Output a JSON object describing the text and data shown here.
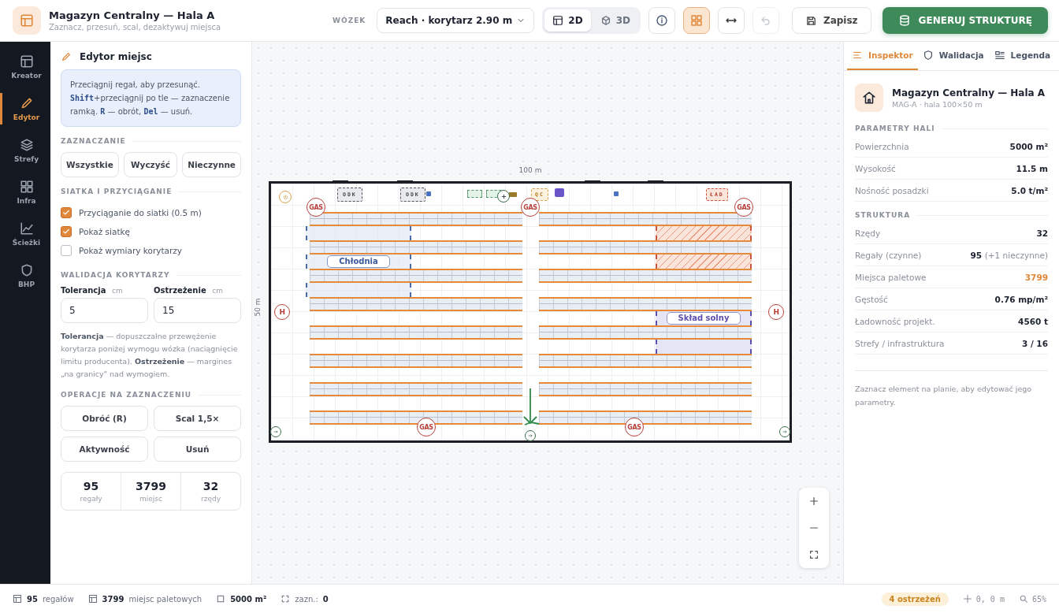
{
  "header": {
    "title": "Magazyn Centralny — Hala A",
    "subtitle": "Zaznacz, przesuń, scal, dezaktywuj miejsca",
    "truck_label": "WÓZEK",
    "truck_value": "Reach · korytarz 2.90 m",
    "views": [
      {
        "label": "2D",
        "kind": "plan",
        "selected": true
      },
      {
        "label": "3D",
        "kind": "cube",
        "selected": false
      }
    ],
    "tools": [
      {
        "kind": "info",
        "selected": false,
        "disabled": false
      },
      {
        "kind": "grid",
        "selected": true,
        "disabled": false
      },
      {
        "kind": "measure",
        "selected": false,
        "disabled": false
      },
      {
        "kind": "undo",
        "selected": false,
        "disabled": true
      }
    ],
    "save": "Zapisz",
    "generate": "GENERUJ STRUKTURĘ"
  },
  "nav": [
    {
      "label": "Kreator",
      "kind": "layout",
      "selected": false
    },
    {
      "label": "Edytor",
      "kind": "pencil",
      "selected": true
    },
    {
      "label": "Strefy",
      "kind": "layers",
      "selected": false
    },
    {
      "label": "Infra",
      "kind": "grid",
      "selected": false
    },
    {
      "label": "Ścieżki",
      "kind": "chart",
      "selected": false
    },
    {
      "label": "BHP",
      "kind": "shield",
      "selected": false
    }
  ],
  "editor": {
    "title": "Edytor miejsc",
    "hint": "Przeciągnij regał, aby przesunąć. **Shift**+przeciągnij po tle — zaznaczenie ramką. **R** — obrót, **Del** — usuń.",
    "selection_heading": "ZAZNACZANIE",
    "selection_buttons": [
      "Wszystkie",
      "Wyczyść",
      "Nieczynne"
    ],
    "grid_heading": "SIATKA I PRZYCIĄGANIE",
    "options": [
      {
        "label": "Przyciąganie do siatki (0.5 m)",
        "checked": true
      },
      {
        "label": "Pokaż siatkę",
        "checked": true
      },
      {
        "label": "Pokaż wymiary korytarzy",
        "checked": false
      }
    ],
    "validation_heading": "WALIDACJA KORYTARZY",
    "fields": [
      {
        "label": "Tolerancja",
        "unit": "cm",
        "value": "5"
      },
      {
        "label": "Ostrzeżenie",
        "unit": "cm",
        "value": "15"
      }
    ],
    "description": "**Tolerancja** — dopuszczalne przewężenie korytarza poniżej wymogu wózka (naciągnięcie limitu producenta). **Ostrzeżenie** — margines „na granicy\" nad wymogiem.",
    "operations_heading": "OPERACJE NA ZAZNACZENIU",
    "operations": [
      "Obróć (R)",
      "Scal 1,5×",
      "Aktywność",
      "Usuń"
    ],
    "stats": [
      {
        "value": "95",
        "label": "regały"
      },
      {
        "value": "3799",
        "label": "miejsc"
      },
      {
        "value": "32",
        "label": "rzędy"
      }
    ]
  },
  "plan": {
    "width_label": "100 m",
    "height_label": "50 m",
    "zones": [
      {
        "kind": "cold",
        "label": "Chłodnia"
      },
      {
        "kind": "hazard"
      },
      {
        "kind": "storage",
        "label": "Skład solny"
      }
    ],
    "stations": [
      {
        "kind": "dock",
        "label": "ODK"
      },
      {
        "kind": "dock",
        "label": "ODK"
      },
      {
        "kind": "qc",
        "label": "QC"
      },
      {
        "kind": "loading",
        "label": "ŁAD"
      }
    ],
    "markers": [
      {
        "kind": "gas",
        "label": "GAS"
      },
      {
        "kind": "gas",
        "label": "GAS"
      },
      {
        "kind": "gas",
        "label": "GAS"
      },
      {
        "kind": "gas",
        "label": "GAS"
      },
      {
        "kind": "gas",
        "label": "GAS"
      },
      {
        "kind": "hydrant",
        "label": "H"
      },
      {
        "kind": "hydrant",
        "label": "H"
      }
    ]
  },
  "inspector": {
    "tabs": [
      {
        "label": "Inspektor",
        "kind": "list",
        "selected": true
      },
      {
        "label": "Walidacja",
        "kind": "shield",
        "selected": false
      },
      {
        "label": "Legenda",
        "kind": "legend",
        "selected": false
      }
    ],
    "title": "Magazyn Centralny — Hala A",
    "subtitle": "MAG-A · hala 100×50 m",
    "sections": [
      {
        "heading": "PARAMETRY HALI",
        "rows": [
          {
            "label": "Powierzchnia",
            "value": "5000 m²",
            "highlight": false
          },
          {
            "label": "Wysokość",
            "value": "11.5 m",
            "highlight": false
          },
          {
            "label": "Nośność posadzki",
            "value": "5.0 t/m²",
            "highlight": false
          }
        ]
      },
      {
        "heading": "STRUKTURA",
        "rows": [
          {
            "label": "Rzędy",
            "value": "32",
            "highlight": false
          },
          {
            "label": "Regały (czynne)",
            "value": "95",
            "note": "(+1 nieczynne)",
            "highlight": false
          },
          {
            "label": "Miejsca paletowe",
            "value": "3799",
            "highlight": true
          },
          {
            "label": "Gęstość",
            "value": "0.76 mp/m²",
            "highlight": false
          },
          {
            "label": "Ładowność projekt.",
            "value": "4560 t",
            "highlight": false
          },
          {
            "label": "Strefy / infrastruktura",
            "value": "3 / 16",
            "highlight": false
          }
        ]
      }
    ],
    "footnote": "Zaznacz element na planie, aby edytować jego parametry."
  },
  "status_bar": {
    "items": [
      {
        "kind": "racks",
        "value": "95",
        "label": "regałów"
      },
      {
        "kind": "pallets",
        "value": "3799",
        "label": "miejsc paletowych"
      },
      {
        "kind": "area",
        "value": "5000 m²"
      },
      {
        "kind": "selection",
        "label": "zazn.:",
        "value": "0"
      }
    ],
    "warnings": "4 ostrzeżeń",
    "cursor": "0, 0 m",
    "zoom": "65%"
  }
}
